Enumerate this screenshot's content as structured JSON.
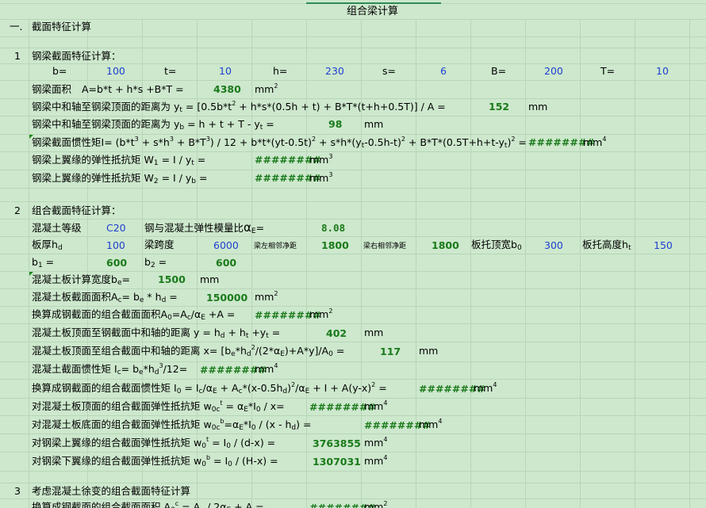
{
  "sheet_title": "组合梁计算",
  "s1": {
    "num": "一.",
    "title": "截面特征计算"
  },
  "s1_1": {
    "num": "1",
    "title": "钢梁截面特征计算："
  },
  "params1": {
    "b_label": "b=",
    "b_val": "100",
    "t_label": "t=",
    "t_val": "10",
    "h_label": "h=",
    "h_val": "230",
    "s_label": "s=",
    "s_val": "6",
    "B_label": "B=",
    "B_val": "200",
    "T_label": "T=",
    "T_val": "10"
  },
  "r_area": {
    "label": "钢梁面积",
    "formula": "A=b*t + h*s +B*T =",
    "value": "4380",
    "unit": "mm"
  },
  "r_yt": {
    "label": "钢梁中和轴至钢梁顶面的距离为",
    "formula_a": "y",
    "formula_b": "= [0.5b*t",
    "formula_c": " + h*s*(0.5h + t) + B*T*(t+h+0.5T)] / A =",
    "value": "152",
    "unit": "mm"
  },
  "r_yb": {
    "label": "钢梁中和轴至钢梁顶面的距离为",
    "formula_a": "y",
    "formula_b": "= h + t + T - y",
    "formula_c": " =",
    "value": "98",
    "unit": "mm"
  },
  "r_I": {
    "label": "钢梁截面惯性矩",
    "formula": "I= (b*t",
    "f2": " + s*h",
    "f3": " + B*T",
    "f4": ") / 12 + b*t*(yt-0.5t)",
    "f5": " + s*h*(y",
    "f6": "-0.5h-t)",
    "f7": " + B*T*(0.5T+h+t-y",
    "f8": ")",
    "f9": " =",
    "value": "########",
    "unit": "mm"
  },
  "r_W1": {
    "label": "钢梁上翼缘的弹性抵抗矩",
    "formula": "W",
    "f2": " = I / y",
    "f3": " =",
    "value": "########",
    "unit": "mm"
  },
  "r_W2": {
    "label": "钢梁上翼缘的弹性抵抗矩",
    "formula": "W",
    "f2": " = I / y",
    "f3": " =",
    "value": "########",
    "unit": "mm"
  },
  "s1_2": {
    "num": "2",
    "title": "组合截面特征计算："
  },
  "r_conc": {
    "label": "混凝土等级",
    "grade": "C20",
    "ratio_label": "钢与混凝土弹性模量比",
    "alpha": "α",
    "sub": "E",
    "eq": "=",
    "ratio_val": "8.08"
  },
  "r_plate": {
    "hd_label": "板厚h",
    "hd_sub": "d",
    "hd_val": "100",
    "span_label": "梁跨度",
    "span_val": "6000",
    "left_label": "梁左相邻净距",
    "left_val": "1800",
    "right_label": "梁右相邻净距",
    "right_val": "1800",
    "b0_label": "板托顶宽b",
    "b0_sub": "0",
    "b0_val": "300",
    "ht_label": "板托高度h",
    "ht_sub": "t",
    "ht_val": "150"
  },
  "r_b12": {
    "b1_label": "b",
    "b1_sub": "1",
    "b1_eq": " =",
    "b1_val": "600",
    "b2_label": "b",
    "b2_sub": "2",
    "b2_eq": " =",
    "b2_val": "600"
  },
  "r_be": {
    "label": "混凝土板计算宽度b",
    "sub": "e",
    "eq": "=",
    "value": "1500",
    "unit": "mm"
  },
  "r_Ac": {
    "label": "混凝土板截面面积A",
    "sub": "c",
    "f": "= b",
    "f2": " * h",
    "f3": " =",
    "value": "150000",
    "unit": "mm"
  },
  "r_A0": {
    "label": "换算成钢截面的组合截面面积A",
    "sub": "0",
    "f": "=A",
    "f2": "/α",
    "f3": " +A =",
    "value": "########",
    "unit": "mm"
  },
  "r_y": {
    "label": "混凝土板顶面至钢截面中和轴的距离",
    "f": "y = h",
    "f2": " + h",
    "f3": " +y",
    "f4": " =",
    "value": "402",
    "unit": "mm"
  },
  "r_x": {
    "label": "混凝土板顶面至组合截面中和轴的距离",
    "f": "x= [b",
    "f2": "*h",
    "f3": "/(2*α",
    "f4": ")+A*y]/A",
    "f5": " =",
    "value": "117",
    "unit": "mm"
  },
  "r_Ic": {
    "label": "混凝土截面惯性矩",
    "f": "I",
    "f2": "= b",
    "f3": "*h",
    "f4": "/12=",
    "value": "########",
    "unit": "mm"
  },
  "r_I0": {
    "label": "换算成钢截面的组合截面惯性矩",
    "f": "I",
    "f2": " = I",
    "f3": "/α",
    "f4": " + A",
    "f5": "*(x-0.5h",
    "f6": ")",
    "f7": "/α",
    "f8": " + I + A(y-x)",
    "f9": " =",
    "value": "########",
    "unit": "mm"
  },
  "r_w0ct": {
    "label": "对混凝土板顶面的组合截面弹性抵抗矩",
    "f": "w",
    "f2": " = α",
    "f3": "*I",
    "f4": " / x=",
    "value": "########",
    "unit": "mm"
  },
  "r_w0cb": {
    "label": "对混凝土板底面的组合截面弹性抵抗矩",
    "f": "w",
    "f2": "=α",
    "f3": "*I",
    "f4": " / (x - h",
    "f5": ") =",
    "value": "########",
    "unit": "mm"
  },
  "r_w0t": {
    "label": "对钢梁上翼缘的组合截面弹性抵抗矩",
    "f": "w",
    "f2": " = I",
    "f3": " / (d-x) =",
    "value": "3763855",
    "unit": "mm"
  },
  "r_w0b": {
    "label": "对钢梁下翼缘的组合截面弹性抵抗矩",
    "f": "w",
    "f2": " = I",
    "f3": " / (H-x) =",
    "value": "1307031",
    "unit": "mm"
  },
  "s1_3": {
    "num": "3",
    "title": "考虑混凝土徐变的组合截面特征计算"
  },
  "r_last": {
    "label": "换算成钢截面的组合截面面积",
    "f": "A",
    "f2": " = A",
    "f3": " / 2α",
    "f4": " + A =",
    "value": "########",
    "unit": "mm"
  },
  "sup2": "2",
  "sup3": "3",
  "sup4": "4",
  "subs": {
    "t": "t",
    "b": "b",
    "one": "1",
    "two": "2",
    "E": "E",
    "e": "e",
    "d": "d",
    "c": "c",
    "zero": "0",
    "zeroc": "0c",
    "s": "s"
  }
}
